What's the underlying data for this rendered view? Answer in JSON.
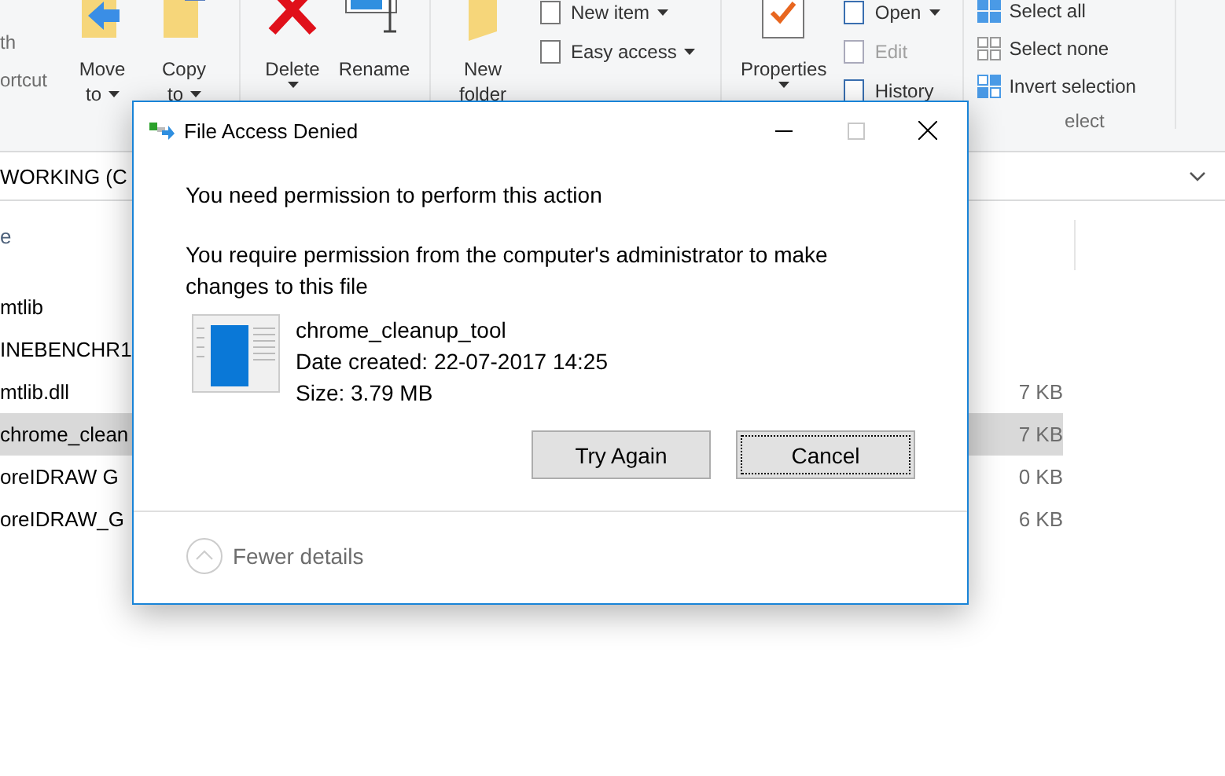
{
  "ribbon": {
    "partial_lines": [
      "th",
      "ortcut"
    ],
    "large": [
      {
        "label": "Move",
        "sub": "to",
        "dropdown": true
      },
      {
        "label": "Copy",
        "sub": "to",
        "dropdown": true
      },
      {
        "label": "Delete",
        "dropdown": true
      },
      {
        "label": "Rename",
        "dropdown": false
      },
      {
        "label": "New",
        "sub": "folder",
        "dropdown": false
      }
    ],
    "new_items": [
      {
        "label": "New item",
        "dropdown": true
      },
      {
        "label": "Easy access",
        "dropdown": true
      }
    ],
    "properties": {
      "label": "Properties",
      "dropdown": true
    },
    "open_items": [
      {
        "label": "Open",
        "dropdown": true,
        "disabled": false
      },
      {
        "label": "Edit",
        "dropdown": false,
        "disabled": true
      },
      {
        "label": "History",
        "dropdown": false,
        "disabled": false
      }
    ],
    "select_items": [
      {
        "label": "Select all"
      },
      {
        "label": "Select none"
      },
      {
        "label": "Invert selection"
      }
    ],
    "select_group_label": "elect"
  },
  "address_bar": {
    "path": "WORKING (C"
  },
  "file_list": {
    "header": "e",
    "rows": [
      {
        "name": "mtlib",
        "selected": false
      },
      {
        "name": "INEBENCHR1",
        "selected": false
      },
      {
        "name": "mtlib.dll",
        "size": "7 KB",
        "selected": false
      },
      {
        "name": "chrome_clean",
        "size": "7 KB",
        "selected": true
      },
      {
        "name": "oreIDRAW G",
        "size": "0 KB",
        "selected": false
      },
      {
        "name": "oreIDRAW_G",
        "size": "6 KB",
        "selected": false
      }
    ]
  },
  "dialog": {
    "title": "File Access Denied",
    "message": "You need permission to perform this action",
    "detail": "You require permission from the computer's administrator to make changes to this file",
    "file": {
      "name": "chrome_cleanup_tool",
      "date": "Date created: 22-07-2017 14:25",
      "size": "Size: 3.79 MB"
    },
    "buttons": [
      {
        "label": "Try Again",
        "focused": false
      },
      {
        "label": "Cancel",
        "focused": true
      }
    ],
    "toggle": "Fewer details"
  }
}
